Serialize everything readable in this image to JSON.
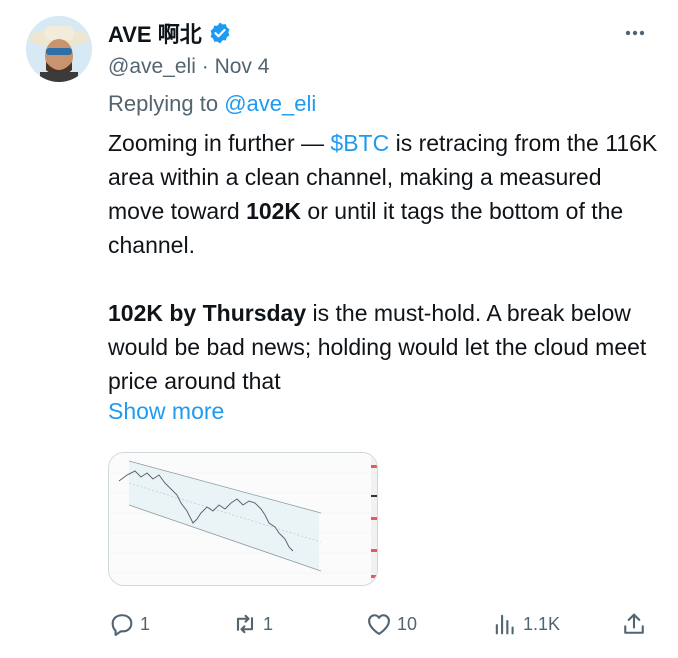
{
  "tweet": {
    "author_name": "AVE 啊北",
    "handle": "@ave_eli",
    "separator": "·",
    "date": "Nov 4",
    "replying_to_label": "Replying to",
    "replying_to_handle": "@ave_eli",
    "body": {
      "p1_a": "Zooming in further — ",
      "p1_cashtag": "$BTC",
      "p1_b": " is retracing from the 116K area within a clean channel, making a measured move toward ",
      "p1_bold": "102K",
      "p1_c": " or until it tags the bottom of the channel.",
      "p2_bold": "102K by Thursday",
      "p2_a": " is the must-hold. A break below would be bad news; holding would let the cloud meet price around that"
    },
    "show_more": "Show more",
    "media_alt": "BTC price chart with descending channel"
  },
  "actions": {
    "replies": "1",
    "reposts": "1",
    "likes": "10",
    "views": "1.1K"
  },
  "icons": [
    "verified-badge-icon",
    "more-icon",
    "reply-icon",
    "repost-icon",
    "like-icon",
    "views-icon",
    "share-icon"
  ],
  "colors": {
    "accent": "#1d9bf0",
    "muted": "#536471",
    "text": "#0f1419"
  }
}
